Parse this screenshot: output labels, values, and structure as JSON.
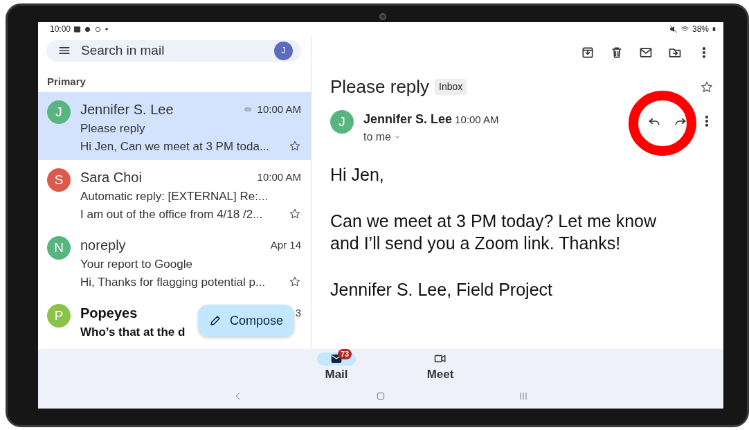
{
  "status_bar": {
    "time": "10:00",
    "battery": "38%"
  },
  "search": {
    "placeholder": "Search in mail",
    "avatar": "J"
  },
  "section": "Primary",
  "emails": [
    {
      "avatar": "J",
      "color": "#57b67f",
      "sender": "Jennifer S. Lee",
      "time": "10:00 AM",
      "subject": "Please reply",
      "snippet": "Hi Jen, Can we meet at 3 PM toda...",
      "selected": true,
      "attachment": true,
      "unread": false,
      "starred": false
    },
    {
      "avatar": "S",
      "color": "#db5a4d",
      "sender": "Sara Choi",
      "time": "10:00 AM",
      "subject": "Automatic reply: [EXTERNAL] Re:...",
      "snippet": "I am out of the office from 4/18 /2...",
      "selected": false,
      "attachment": false,
      "unread": false,
      "starred": false
    },
    {
      "avatar": "N",
      "color": "#57b67f",
      "sender": "noreply",
      "time": "Apr 14",
      "subject": "Your report to Google",
      "snippet": "Hi, Thanks for flagging potential p...",
      "selected": false,
      "attachment": false,
      "unread": false,
      "starred": false
    },
    {
      "avatar": "P",
      "color": "#8bc34a",
      "sender": "Popeyes",
      "time": "3",
      "subject": "Who’s that at the d",
      "selected": false,
      "attachment": false,
      "unread": true
    }
  ],
  "compose": {
    "label": "Compose"
  },
  "message": {
    "subject": "Please reply",
    "label": "Inbox",
    "starred": false,
    "avatar": "J",
    "sender": "Jennifer S. Lee",
    "time": "10:00 AM",
    "recipient": "to me",
    "body": [
      "Hi Jen,",
      "Can we meet at 3 PM today? Let me know and I’ll send you a Zoom link. Thanks!",
      "Jennifer S. Lee, Field Project"
    ]
  },
  "bottom_nav": [
    {
      "kind": "mail",
      "label": "Mail",
      "badge": "73",
      "selected": true
    },
    {
      "kind": "meet",
      "label": "Meet",
      "selected": false
    }
  ]
}
